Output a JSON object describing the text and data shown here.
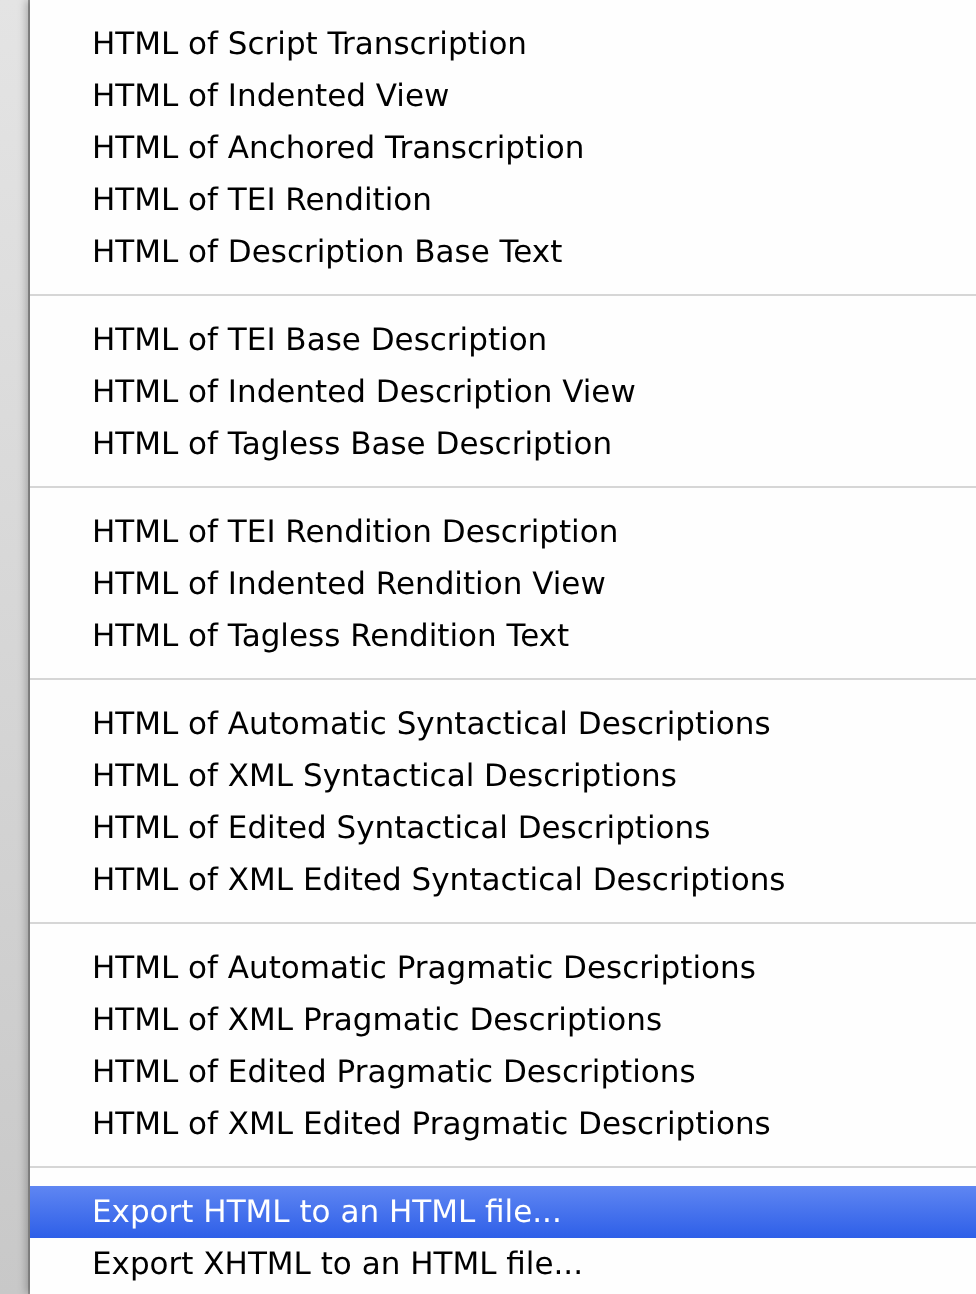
{
  "menu": {
    "groups": [
      {
        "items": [
          {
            "label": "HTML of Script Transcription",
            "selected": false
          },
          {
            "label": "HTML of Indented View",
            "selected": false
          },
          {
            "label": "HTML of Anchored Transcription",
            "selected": false
          },
          {
            "label": "HTML of TEI Rendition",
            "selected": false
          },
          {
            "label": "HTML of Description Base Text",
            "selected": false
          }
        ]
      },
      {
        "items": [
          {
            "label": "HTML of TEI Base Description",
            "selected": false
          },
          {
            "label": "HTML of Indented Description View",
            "selected": false
          },
          {
            "label": "HTML of Tagless Base Description",
            "selected": false
          }
        ]
      },
      {
        "items": [
          {
            "label": "HTML of TEI Rendition Description",
            "selected": false
          },
          {
            "label": "HTML of Indented Rendition View",
            "selected": false
          },
          {
            "label": "HTML of Tagless Rendition Text",
            "selected": false
          }
        ]
      },
      {
        "items": [
          {
            "label": "HTML of Automatic Syntactical Descriptions",
            "selected": false
          },
          {
            "label": "HTML of XML Syntactical Descriptions",
            "selected": false
          },
          {
            "label": "HTML of Edited Syntactical Descriptions",
            "selected": false
          },
          {
            "label": "HTML of XML Edited Syntactical Descriptions",
            "selected": false
          }
        ]
      },
      {
        "items": [
          {
            "label": "HTML of Automatic Pragmatic Descriptions",
            "selected": false
          },
          {
            "label": "HTML of XML Pragmatic Descriptions",
            "selected": false
          },
          {
            "label": "HTML of Edited Pragmatic Descriptions",
            "selected": false
          },
          {
            "label": "HTML of XML Edited Pragmatic Descriptions",
            "selected": false
          }
        ]
      },
      {
        "items": [
          {
            "label": "Export HTML to an HTML file...",
            "selected": true
          },
          {
            "label": "Export XHTML to an HTML file...",
            "selected": false
          }
        ]
      }
    ]
  }
}
